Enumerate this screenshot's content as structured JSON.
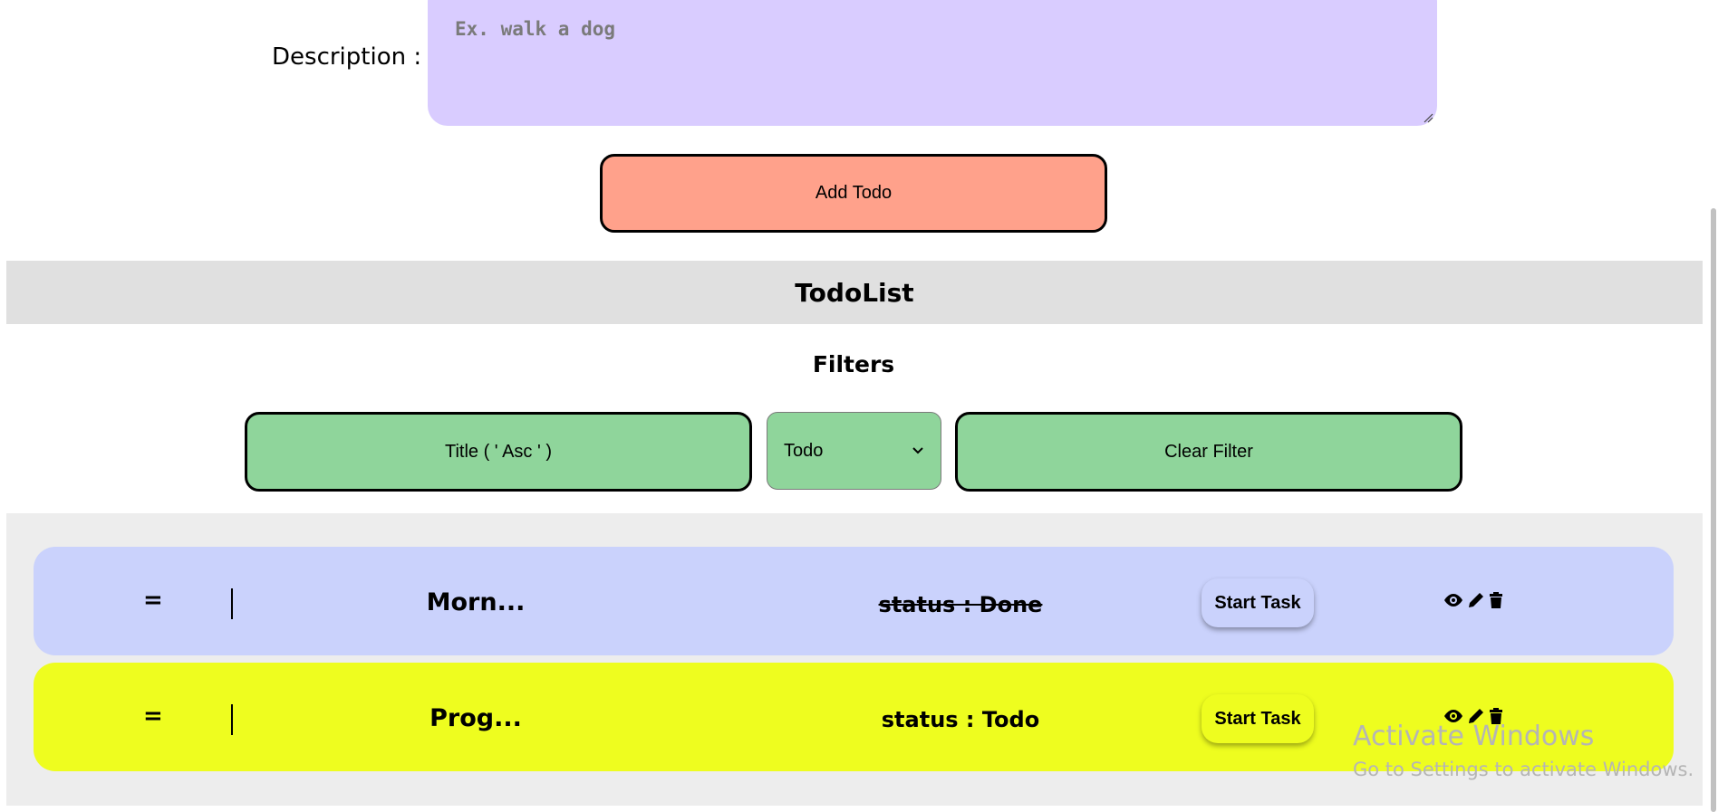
{
  "form": {
    "description_label": "Description :",
    "description_placeholder": "Ex. walk a dog",
    "add_button_label": "Add Todo"
  },
  "list": {
    "header_title": "TodoList",
    "filters_title": "Filters",
    "filters": {
      "title_sort_label": "Title ( ' Asc ' )",
      "status_select_value": "Todo",
      "clear_label": "Clear Filter"
    },
    "items": [
      {
        "drag_glyph": "=",
        "title": "Morn...",
        "status": "status : Done",
        "action_label": "Start Task",
        "color": "#cad2fc",
        "status_struck": true
      },
      {
        "drag_glyph": "=",
        "title": "Prog...",
        "status": "status : Todo",
        "action_label": "Start Task",
        "color": "#eefd1f",
        "status_struck": false
      }
    ]
  },
  "watermark": {
    "title": "Activate Windows",
    "subtitle": "Go to Settings to activate Windows."
  },
  "colors": {
    "description_bg": "#d9ccff",
    "add_button_bg": "#ffa18b",
    "filter_bg": "#8fd59b",
    "header_bg": "#e0e0e0",
    "panel_bg": "#ededed"
  },
  "icons": [
    "eye-icon",
    "pencil-icon",
    "trash-icon"
  ]
}
